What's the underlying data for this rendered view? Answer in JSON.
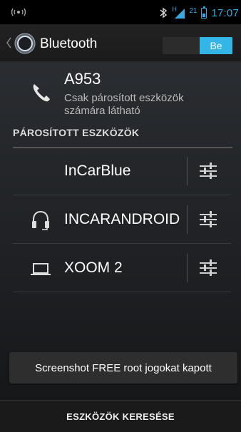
{
  "status_bar": {
    "time": "17:07",
    "battery_level": "21",
    "network_type": "H",
    "icons": [
      "wifi-tether-icon",
      "bluetooth-icon",
      "signal-icon",
      "battery-icon"
    ]
  },
  "action_bar": {
    "title": "Bluetooth",
    "toggle_on_label": "Be",
    "app_icon": "bluetooth-app-icon"
  },
  "device": {
    "name": "A953",
    "status": "Csak párosított eszközök számára látható",
    "icon": "phone-icon"
  },
  "paired_section": {
    "header": "PÁROSÍTOTT ESZKÖZÖK",
    "items": [
      {
        "label": "InCarBlue",
        "icon": ""
      },
      {
        "label": "INCARANDROID",
        "icon": "headset-icon"
      },
      {
        "label": "XOOM 2",
        "icon": "laptop-icon"
      }
    ]
  },
  "toast": {
    "text": "Screenshot FREE root jogokat kapott"
  },
  "bottom_bar": {
    "label": "ESZKÖZÖK KERESÉSE"
  },
  "colors": {
    "accent": "#33b5e5",
    "background": "#000000"
  }
}
